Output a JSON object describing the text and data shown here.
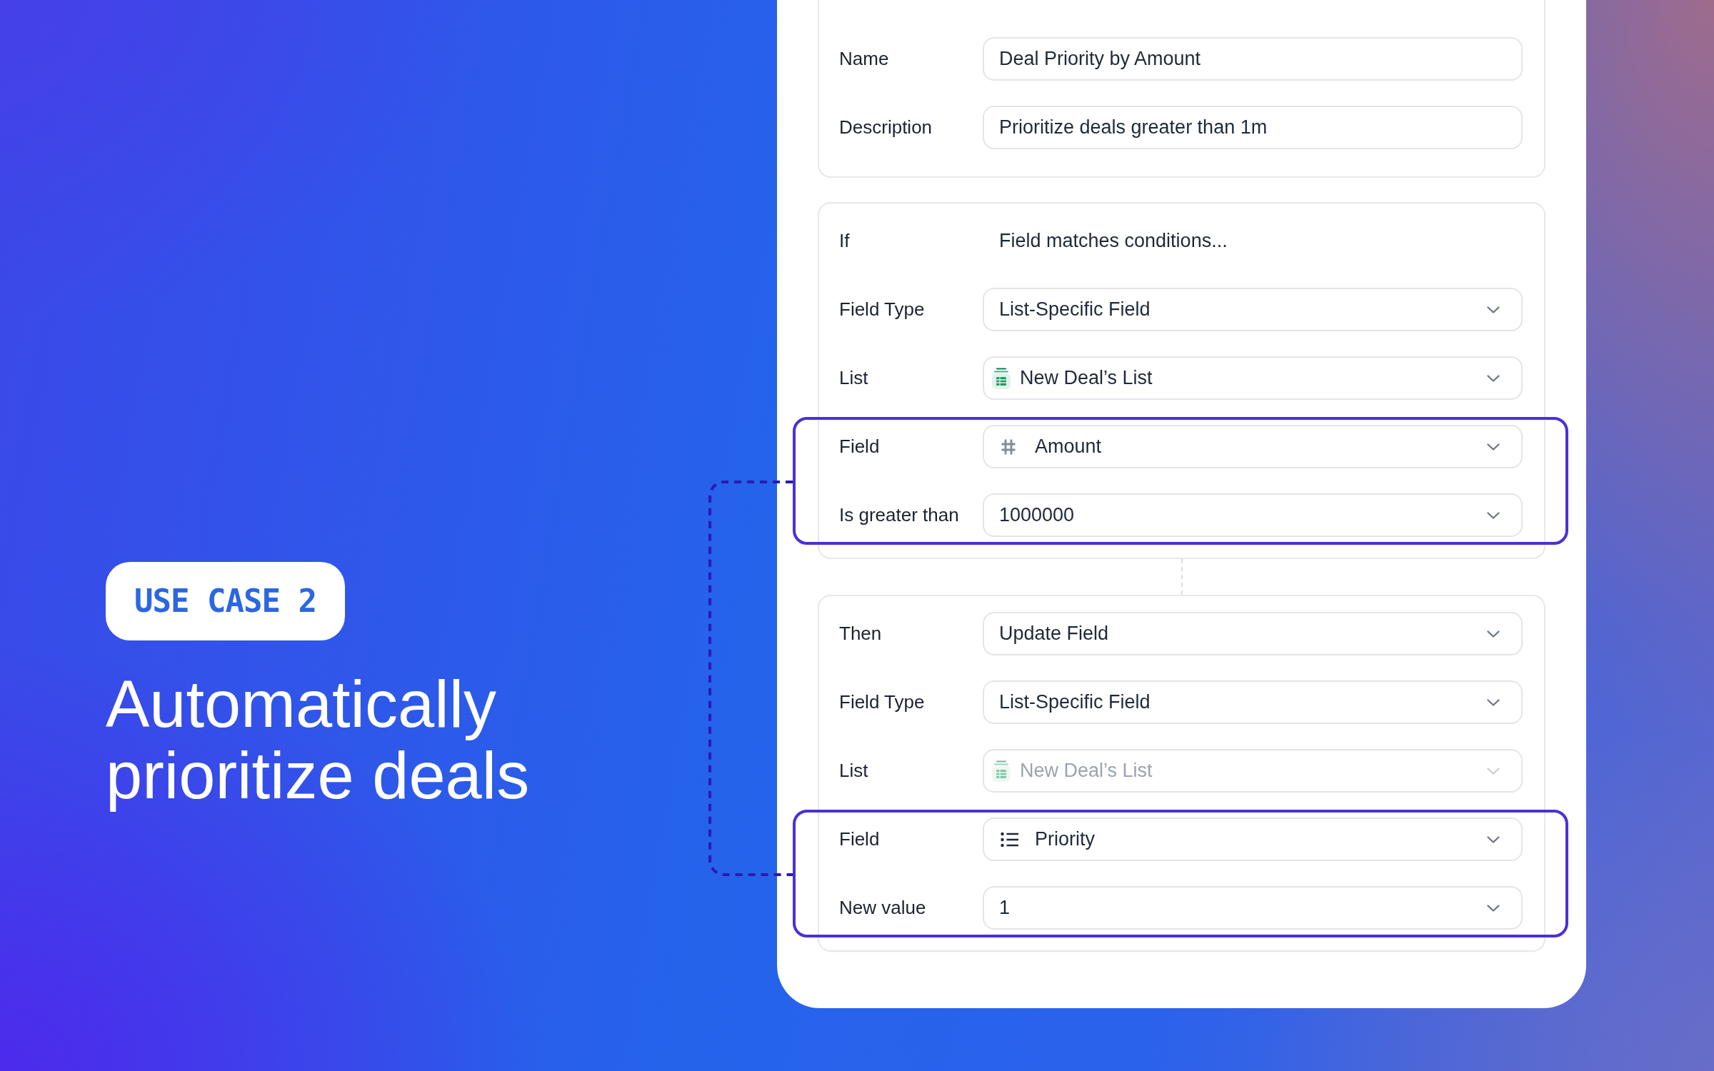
{
  "badge": {
    "label": "USE CASE 2"
  },
  "headline": "Automatically prioritize deals",
  "cards": [
    {
      "connector_above": false,
      "sections": [
        {
          "highlighted": false,
          "rows": [
            {
              "label": "Name",
              "kind": "input",
              "value": "Deal Priority by Amount",
              "disabled": false
            },
            {
              "label": "Description",
              "kind": "input",
              "value": "Prioritize deals greater than 1m",
              "disabled": false
            }
          ]
        }
      ]
    },
    {
      "connector_above": false,
      "sections": [
        {
          "highlighted": false,
          "rows": [
            {
              "label": "If",
              "kind": "text",
              "value": "Field matches conditions...",
              "disabled": false
            },
            {
              "label": "Field Type",
              "kind": "select",
              "value": "List-Specific Field",
              "disabled": false
            },
            {
              "label": "List",
              "kind": "list",
              "value": "New Deal’s List",
              "disabled": false
            }
          ]
        },
        {
          "highlighted": true,
          "rows": [
            {
              "label": "Field",
              "kind": "number",
              "value": "Amount",
              "disabled": false
            },
            {
              "label": "Is greater than",
              "kind": "select",
              "value": "1000000",
              "disabled": false
            }
          ]
        }
      ]
    },
    {
      "connector_above": true,
      "sections": [
        {
          "highlighted": false,
          "rows": [
            {
              "label": "Then",
              "kind": "select",
              "value": "Update Field",
              "disabled": false
            },
            {
              "label": "Field Type",
              "kind": "select",
              "value": "List-Specific Field",
              "disabled": false
            },
            {
              "label": "List",
              "kind": "list",
              "value": "New Deal’s List",
              "disabled": true
            }
          ]
        },
        {
          "highlighted": true,
          "rows": [
            {
              "label": "Field",
              "kind": "choice",
              "value": "Priority",
              "disabled": false
            },
            {
              "label": "New value",
              "kind": "select",
              "value": "1",
              "disabled": false
            }
          ]
        }
      ]
    }
  ]
}
